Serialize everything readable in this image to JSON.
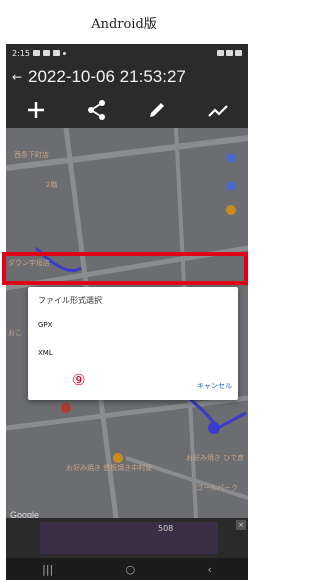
{
  "caption": "Android版",
  "status": {
    "time": "2:15"
  },
  "appbar": {
    "title": "2022-10-06 21:53:27",
    "back_glyph": "←"
  },
  "toolbar": [
    "plus-icon",
    "share-icon",
    "pencil-icon",
    "chart-line-icon"
  ],
  "map": {
    "labels": [
      "西条下町店",
      "2階",
      "ダウン宇垣店",
      "おこ",
      "お好み焼き 鉄板焼き中村屋",
      "お好み焼き 鉄板焼き中村屋",
      "お好み焼き ひで彦",
      "ゴールパーク"
    ],
    "google_label": "Google"
  },
  "dialog": {
    "title": "ファイル形式選択",
    "options": [
      "GPX",
      "XML"
    ],
    "cancel": "キャンセル"
  },
  "annotation": {
    "marker": "⑨"
  },
  "ad": {
    "badge": "508"
  },
  "navbar": {
    "recent": "|||",
    "home": "○",
    "back": "‹"
  },
  "colors": {
    "highlight": "#e1001a",
    "accent": "#1e63c8"
  }
}
